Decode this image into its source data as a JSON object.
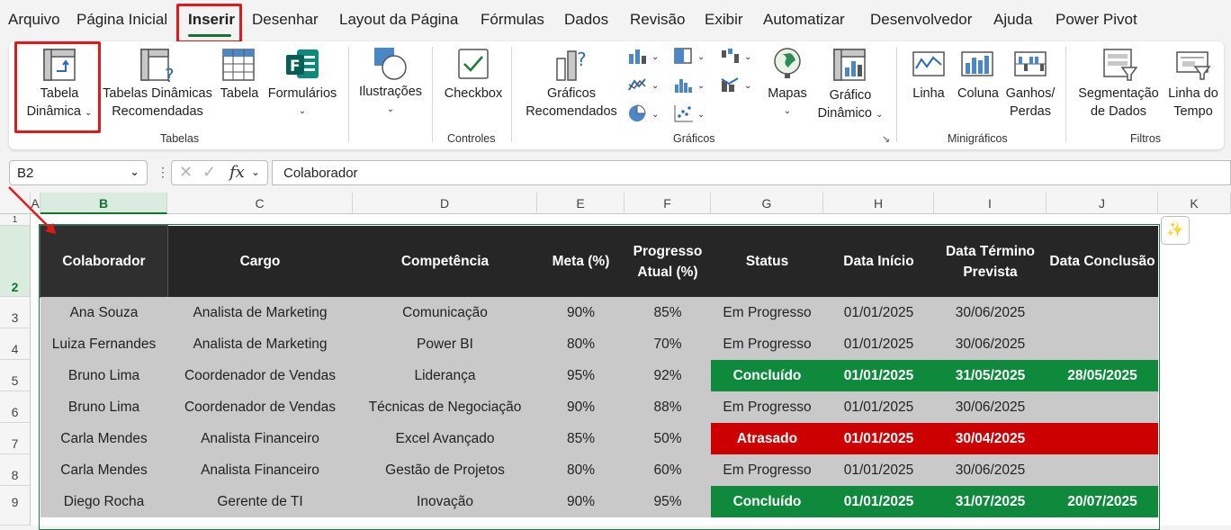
{
  "menu": [
    "Arquivo",
    "Página Inicial",
    "Inserir",
    "Desenhar",
    "Layout da Página",
    "Fórmulas",
    "Dados",
    "Revisão",
    "Exibir",
    "Automatizar",
    "Desenvolvedor",
    "Ajuda",
    "Power Pivot"
  ],
  "ribbon": {
    "tabela_dinamica": [
      "Tabela",
      "Dinâmica"
    ],
    "tabelas_recomendadas": [
      "Tabelas Dinâmicas",
      "Recomendadas"
    ],
    "tabela": "Tabela",
    "formularios": "Formulários",
    "ilustracoes": "Ilustrações",
    "checkbox": "Checkbox",
    "graficos_recomendados": [
      "Gráficos",
      "Recomendados"
    ],
    "mapas": "Mapas",
    "grafico_dinamico": [
      "Gráfico",
      "Dinâmico"
    ],
    "linha": "Linha",
    "coluna": "Coluna",
    "ganhos_perdas": [
      "Ganhos/",
      "Perdas"
    ],
    "segmentacao": [
      "Segmentação",
      "de Dados"
    ],
    "linha_tempo": [
      "Linha do",
      "Tempo"
    ],
    "groups": {
      "tabelas": "Tabelas",
      "controles": "Controles",
      "graficos": "Gráficos",
      "minigraficos": "Minigráficos",
      "filtros": "Filtros"
    }
  },
  "formula_bar": {
    "name_box": "B2",
    "formula": "Colaborador",
    "fx": "fx"
  },
  "columns": [
    "A",
    "B",
    "C",
    "D",
    "E",
    "F",
    "G",
    "H",
    "I",
    "J",
    "K"
  ],
  "rows": [
    "1",
    "2",
    "3",
    "4",
    "5",
    "6",
    "7",
    "8",
    "9"
  ],
  "table": {
    "headers": [
      "Colaborador",
      "Cargo",
      "Competência",
      "Meta (%)",
      "Progresso Atual (%)",
      "Status",
      "Data Início",
      "Data Término Prevista",
      "Data Conclusão"
    ],
    "rows": [
      {
        "status_type": "progress",
        "cells": [
          "Ana Souza",
          "Analista de Marketing",
          "Comunicação",
          "90%",
          "85%",
          "Em Progresso",
          "01/01/2025",
          "30/06/2025",
          ""
        ]
      },
      {
        "status_type": "progress",
        "cells": [
          "Luiza Fernandes",
          "Analista de Marketing",
          "Power BI",
          "80%",
          "70%",
          "Em Progresso",
          "01/01/2025",
          "30/06/2025",
          ""
        ]
      },
      {
        "status_type": "done",
        "cells": [
          "Bruno Lima",
          "Coordenador de Vendas",
          "Liderança",
          "95%",
          "92%",
          "Concluído",
          "01/01/2025",
          "31/05/2025",
          "28/05/2025"
        ]
      },
      {
        "status_type": "progress",
        "cells": [
          "Bruno Lima",
          "Coordenador de Vendas",
          "Técnicas de Negociação",
          "90%",
          "88%",
          "Em Progresso",
          "01/01/2025",
          "30/06/2025",
          ""
        ]
      },
      {
        "status_type": "late",
        "cells": [
          "Carla Mendes",
          "Analista Financeiro",
          "Excel Avançado",
          "85%",
          "50%",
          "Atrasado",
          "01/01/2025",
          "30/04/2025",
          ""
        ]
      },
      {
        "status_type": "progress",
        "cells": [
          "Carla Mendes",
          "Analista Financeiro",
          "Gestão de Projetos",
          "80%",
          "60%",
          "Em Progresso",
          "01/01/2025",
          "30/06/2025",
          ""
        ]
      },
      {
        "status_type": "done",
        "cells": [
          "Diego Rocha",
          "Gerente de TI",
          "Inovação",
          "90%",
          "95%",
          "Concluído",
          "01/01/2025",
          "31/07/2025",
          "20/07/2025"
        ]
      }
    ]
  },
  "colors": {
    "header_bg": "#262626",
    "row_bg": "#c9c9c9",
    "done": "#0f8a3c",
    "late": "#cc0000",
    "accent": "#137333",
    "highlight": "#e01919"
  }
}
